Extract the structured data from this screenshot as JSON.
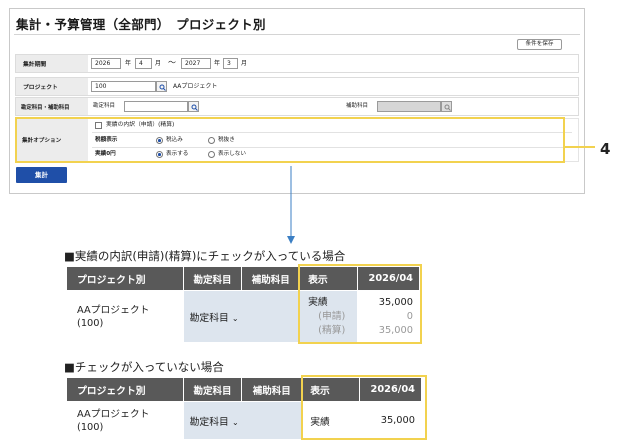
{
  "form": {
    "title": "集計・予算管理（全部門）　プロジェクト別",
    "save_condition": "条件を保存",
    "period": {
      "label": "集計期間",
      "from_year": "2026",
      "year_unit": "年",
      "from_month": "4",
      "month_unit": "月",
      "tilde": "〜",
      "to_year": "2027",
      "to_month": "3"
    },
    "project": {
      "label": "プロジェクト",
      "code": "100",
      "name": "AAプロジェクト"
    },
    "account": {
      "label": "勘定科目・補助科目",
      "account_label": "勘定科目",
      "sub_label": "補助科目"
    },
    "options": {
      "label": "集計オプション",
      "breakdown_checkbox": "実績の内訳（申請）(精算)",
      "tax_label": "税額表示",
      "tax_in": "税込み",
      "tax_out": "税抜き",
      "zero_label": "実績0円",
      "zero_show": "表示する",
      "zero_hide": "表示しない"
    },
    "run": "集計"
  },
  "callout_number": "4",
  "checked_case": {
    "caption": "■実績の内訳(申請)(精算)にチェックが入っている場合",
    "headers": {
      "project": "プロジェクト別",
      "account": "勘定科目",
      "sub": "補助科目",
      "display": "表示",
      "date": "2026/04"
    },
    "project_name": "AAプロジェクト",
    "project_code": "(100)",
    "account_value": "勘定科目",
    "rows": [
      {
        "label": "実績",
        "value": "35,000"
      },
      {
        "label": "(申請)",
        "value": "0"
      },
      {
        "label": "(精算)",
        "value": "35,000"
      }
    ]
  },
  "unchecked_case": {
    "caption": "■チェックが入っていない場合",
    "headers": {
      "project": "プロジェクト別",
      "account": "勘定科目",
      "sub": "補助科目",
      "display": "表示",
      "date": "2026/04"
    },
    "project_name": "AAプロジェクト",
    "project_code": "(100)",
    "account_value": "勘定科目",
    "rows": [
      {
        "label": "実績",
        "value": "35,000"
      }
    ]
  },
  "colors": {
    "highlight": "#f2d24f",
    "primary": "#1f4fa8",
    "header": "#595959",
    "sub_bg": "#dde5ee",
    "arrow": "#3b7fc4"
  }
}
